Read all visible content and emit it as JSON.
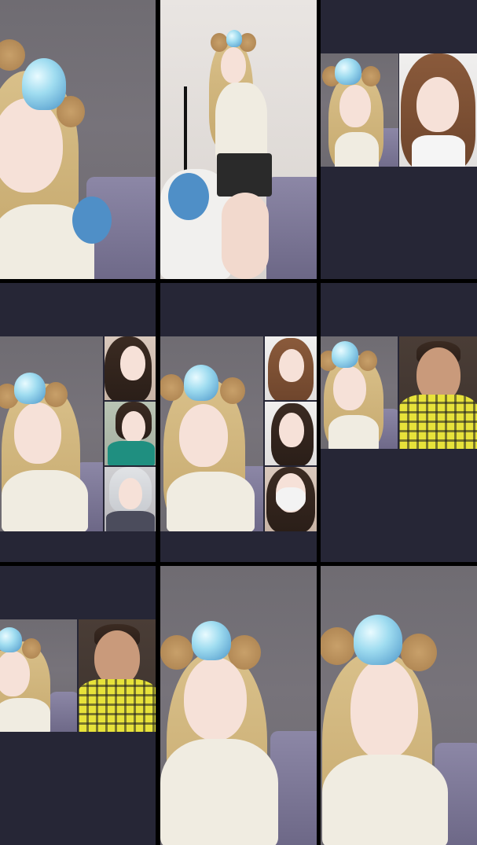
{
  "screen": {
    "background": "#000000",
    "tile_background": "#262636"
  },
  "grid": {
    "rows": 3,
    "columns": 3,
    "tiles": [
      {
        "id": "tile-1",
        "participants": 1,
        "layout": "single"
      },
      {
        "id": "tile-2",
        "participants": 1,
        "layout": "single"
      },
      {
        "id": "tile-3",
        "participants": 2,
        "layout": "side-by-side"
      },
      {
        "id": "tile-4",
        "participants": 4,
        "layout": "main-plus-three"
      },
      {
        "id": "tile-5",
        "participants": 4,
        "layout": "main-plus-three"
      },
      {
        "id": "tile-6",
        "participants": 2,
        "layout": "side-by-side"
      },
      {
        "id": "tile-7",
        "participants": 2,
        "layout": "side-by-side"
      },
      {
        "id": "tile-8",
        "participants": 1,
        "layout": "single"
      },
      {
        "id": "tile-9",
        "participants": 1,
        "layout": "single"
      }
    ]
  },
  "colors": {
    "hat": "#9fdcf0",
    "hair": "#d9c08a",
    "bedding": "#8c87a6",
    "plaid_shirt": "#e7e23a"
  }
}
